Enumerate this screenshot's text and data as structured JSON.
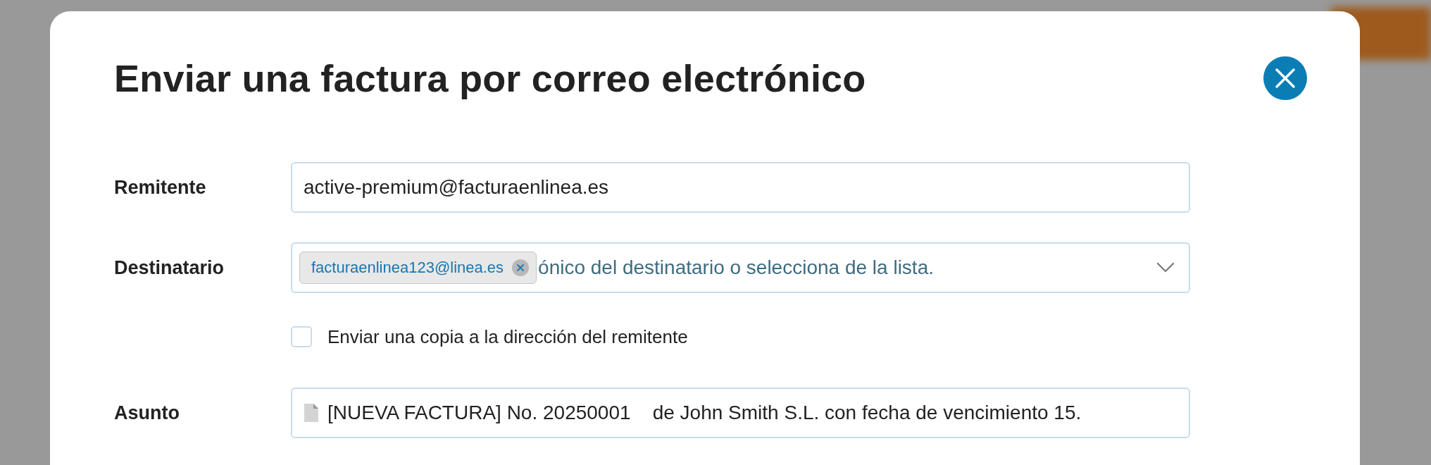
{
  "dialog": {
    "title": "Enviar una factura por correo electrónico"
  },
  "fields": [
    {
      "kind": "text",
      "label": "Remitente",
      "value": "active-premium@facturaenlinea.es"
    },
    {
      "kind": "tags",
      "label": "Destinatario",
      "tags": [
        "facturaenlinea123@linea.es"
      ],
      "placeholder": "ónico del destinatario o selecciona de la lista."
    },
    {
      "kind": "checkbox",
      "label": "Enviar una copia a la dirección del remitente",
      "checked": false
    },
    {
      "kind": "subject",
      "label": "Asunto",
      "value": "[NUEVA FACTURA] No. 20250001    de John Smith S.L. con fecha de vencimiento 15."
    }
  ]
}
